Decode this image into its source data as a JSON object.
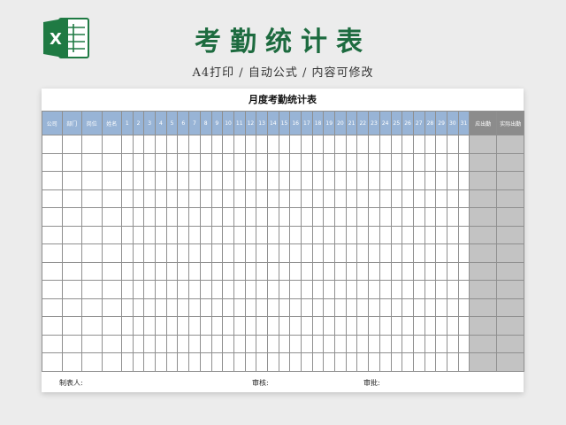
{
  "header": {
    "title": "考勤统计表",
    "subtitle": "A4打印 / 自动公式 / 内容可修改",
    "logo_icon": "excel-logo-icon"
  },
  "sheet": {
    "title": "月度考勤统计表",
    "columns": [
      "公司",
      "部门",
      "岗位",
      "姓名",
      "1",
      "2",
      "3",
      "4",
      "5",
      "6",
      "7",
      "8",
      "9",
      "10",
      "11",
      "12",
      "13",
      "14",
      "15",
      "16",
      "17",
      "18",
      "19",
      "20",
      "21",
      "22",
      "23",
      "24",
      "25",
      "26",
      "27",
      "28",
      "29",
      "30",
      "31",
      "应出勤",
      "实际出勤"
    ],
    "body_row_count": 13,
    "footer": {
      "maker": "制表人:",
      "reviewer": "审核:",
      "approver": "审批:"
    }
  },
  "colors": {
    "title_green": "#1d6b3f",
    "header_blue": "#98b4d6",
    "summary_header_gray": "#8c8c8c",
    "summary_cell_gray": "#c3c3c3"
  }
}
